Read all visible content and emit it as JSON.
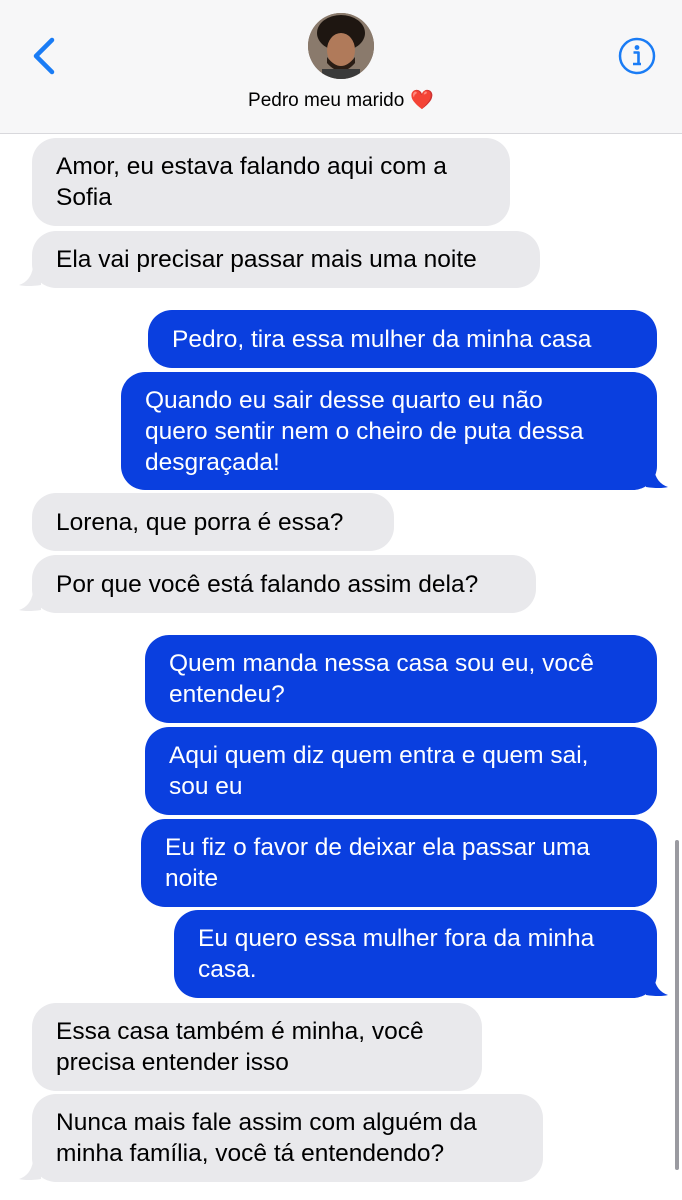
{
  "header": {
    "contact_name": "Pedro meu marido",
    "contact_emoji": "❤️",
    "back_icon": "chevron-left-icon",
    "info_icon": "info-circle-icon",
    "accent_color": "#1a7cf5"
  },
  "colors": {
    "incoming_bubble": "#e9e9ec",
    "outgoing_bubble": "#0a3fdf"
  },
  "messages": [
    {
      "direction": "incoming",
      "text": "Amor, eu estava falando aqui com a\nSofia"
    },
    {
      "direction": "incoming",
      "text": "Ela vai precisar passar mais uma noite"
    },
    {
      "direction": "outgoing",
      "text": "Pedro, tira essa mulher da minha casa"
    },
    {
      "direction": "outgoing",
      "text": "Quando eu sair desse quarto eu não\nquero sentir nem o cheiro de puta dessa\ndesgraçada!"
    },
    {
      "direction": "incoming",
      "text": "Lorena, que porra é essa?"
    },
    {
      "direction": "incoming",
      "text": "Por que você está falando assim dela?"
    },
    {
      "direction": "outgoing",
      "text": "Quem manda nessa casa sou eu, você\nentendeu?"
    },
    {
      "direction": "outgoing",
      "text": "Aqui quem diz quem entra e quem sai,\nsou eu"
    },
    {
      "direction": "outgoing",
      "text": "Eu fiz o favor de deixar ela passar uma\nnoite"
    },
    {
      "direction": "outgoing",
      "text": "Eu quero essa mulher fora da minha\ncasa."
    },
    {
      "direction": "incoming",
      "text": "Essa casa também é minha, você\nprecisa entender isso"
    },
    {
      "direction": "incoming",
      "text": "Nunca mais fale assim com alguém da\nminha família, você tá entendendo?"
    }
  ]
}
